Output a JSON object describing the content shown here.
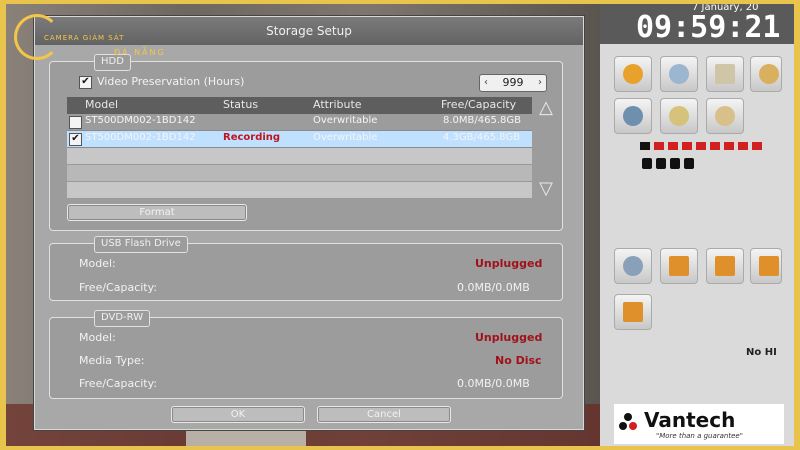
{
  "logo": {
    "line1": "CAMERA GIÁM SÁT",
    "line2": "ĐÀ NẴNG"
  },
  "dialog": {
    "title": "Storage Setup",
    "hdd": {
      "group_label": "HDD",
      "video_preservation_label": "Video Preservation (Hours)",
      "video_preservation_checked": true,
      "hours_value": "999",
      "columns": [
        "Model",
        "Status",
        "Attribute",
        "Free/Capacity"
      ],
      "rows": [
        {
          "checked": false,
          "model": "ST500DM002-1BD142",
          "status": "",
          "attribute": "Overwritable",
          "capacity": "8.0MB/465.8GB",
          "selected": false
        },
        {
          "checked": true,
          "model": "ST500DM002-1BD142",
          "status": "Recording",
          "attribute": "Overwritable",
          "capacity": "4.3GB/465.8GB",
          "selected": true
        }
      ],
      "format_button": "Format"
    },
    "usb": {
      "group_label": "USB Flash Drive",
      "model_label": "Model:",
      "model_value": "Unplugged",
      "free_label": "Free/Capacity:",
      "free_value": "0.0MB/0.0MB"
    },
    "dvd": {
      "group_label": "DVD-RW",
      "model_label": "Model:",
      "model_value": "Unplugged",
      "media_label": "Media Type:",
      "media_value": "No Disc",
      "free_label": "Free/Capacity:",
      "free_value": "0.0MB/0.0MB"
    },
    "ok_button": "OK",
    "cancel_button": "Cancel"
  },
  "panel": {
    "date": "7 January, 20",
    "clock": "09:59:21",
    "no_hdd": "No HI",
    "brand": "Vantech",
    "slogan": "\"More than a guarantee\""
  },
  "colors": {
    "frame_border": "#e9c44c",
    "recording": "#c0141c",
    "unplugged": "#a0121a"
  }
}
